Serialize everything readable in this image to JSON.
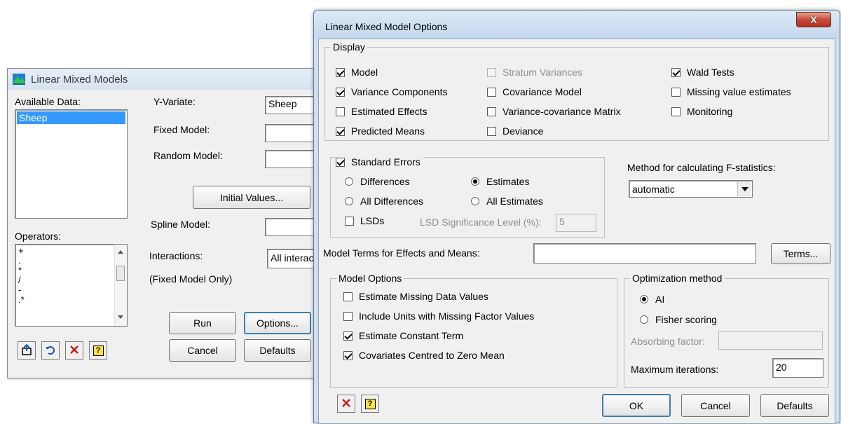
{
  "back_dialog": {
    "title": "Linear Mixed Models",
    "available_data_label": "Available Data:",
    "available_data_items": [
      "Sheep"
    ],
    "operators_label": "Operators:",
    "operators_items": [
      "+",
      ".",
      "*",
      "/",
      "-",
      ".*"
    ],
    "y_variate_label": "Y-Variate:",
    "y_variate_value": "Sheep",
    "fixed_model_label": "Fixed Model:",
    "fixed_model_value": "",
    "random_model_label": "Random Model:",
    "random_model_value": "",
    "initial_values_button": "Initial Values...",
    "spline_model_label": "Spline Model:",
    "spline_model_value": "",
    "interactions_label": "Interactions:",
    "interactions_value": "All interact",
    "interactions_note": "(Fixed Model Only)",
    "run_button": "Run",
    "options_button": "Options...",
    "cancel_button": "Cancel",
    "defaults_button": "Defaults"
  },
  "options_dialog": {
    "title": "Linear Mixed Model Options",
    "close_glyph": "X",
    "display_group": {
      "title": "Display",
      "items": [
        {
          "label": "Model",
          "checked": true,
          "enabled": true
        },
        {
          "label": "Variance Components",
          "checked": true,
          "enabled": true
        },
        {
          "label": "Estimated Effects",
          "checked": false,
          "enabled": true
        },
        {
          "label": "Predicted Means",
          "checked": true,
          "enabled": true
        },
        {
          "label": "Stratum Variances",
          "checked": false,
          "enabled": false
        },
        {
          "label": "Covariance Model",
          "checked": false,
          "enabled": true
        },
        {
          "label": "Variance-covariance Matrix",
          "checked": false,
          "enabled": true
        },
        {
          "label": "Deviance",
          "checked": false,
          "enabled": true
        },
        {
          "label": "Wald Tests",
          "checked": true,
          "enabled": true
        },
        {
          "label": "Missing value estimates",
          "checked": false,
          "enabled": true
        },
        {
          "label": "Monitoring",
          "checked": false,
          "enabled": true
        }
      ]
    },
    "standard_errors": {
      "label": "Standard Errors",
      "checked": true,
      "differences": "Differences",
      "all_differences": "All Differences",
      "estimates": "Estimates",
      "all_estimates": "All Estimates",
      "selected": "Estimates",
      "lsds_label": "LSDs",
      "lsds_checked": false,
      "lsd_level_label": "LSD Significance Level (%):",
      "lsd_level_value": "5"
    },
    "f_stat": {
      "label": "Method for calculating F-statistics:",
      "value": "automatic"
    },
    "model_terms": {
      "label": "Model Terms for Effects and Means:",
      "value": "",
      "button": "Terms..."
    },
    "model_options": {
      "title": "Model Options",
      "items": [
        {
          "label": "Estimate Missing Data Values",
          "checked": false
        },
        {
          "label": "Include Units with Missing Factor Values",
          "checked": false
        },
        {
          "label": "Estimate Constant Term",
          "checked": true
        },
        {
          "label": "Covariates Centred to Zero Mean",
          "checked": true
        }
      ]
    },
    "optimization": {
      "title": "Optimization method",
      "ai_label": "AI",
      "fisher_label": "Fisher scoring",
      "selected": "AI",
      "absorbing_label": "Absorbing factor:",
      "absorbing_value": "",
      "max_iter_label": "Maximum iterations:",
      "max_iter_value": "20"
    },
    "ok_button": "OK",
    "cancel_button": "Cancel",
    "defaults_button": "Defaults"
  },
  "colors": {
    "dialog_bg": "#f0f0f0",
    "selection": "#3399ff",
    "close_red": "#c74a3b",
    "disabled_text": "#8f8f8f"
  }
}
